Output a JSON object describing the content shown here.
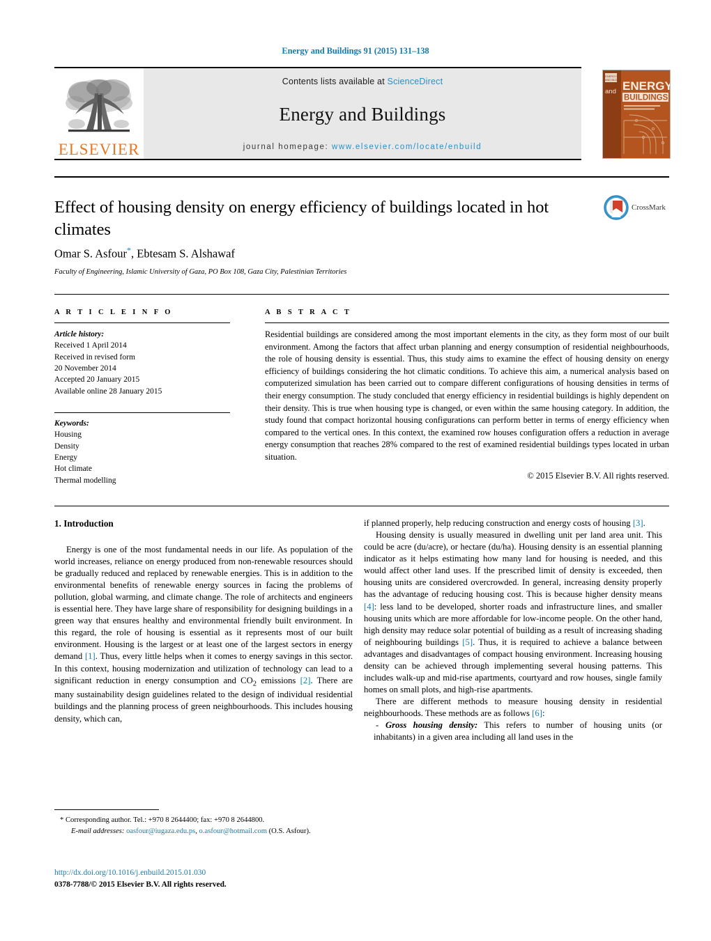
{
  "running_head": "Energy and Buildings 91 (2015) 131–138",
  "masthead": {
    "contents_prefix": "Contents lists available at ",
    "sciencedirect": "ScienceDirect",
    "journal_name": "Energy and Buildings",
    "homepage_prefix": "journal homepage: ",
    "homepage_url": "www.elsevier.com/locate/enbuild",
    "publisher_wordmark": "ELSEVIER",
    "cover_line_and": "and",
    "cover_line_energy": "ENERGY",
    "cover_line_buildings": "BUILDINGS",
    "link_color": "#2a8fc4",
    "band_bg": "#e8e8e8",
    "elsevier_orange": "#e87722"
  },
  "article": {
    "title": "Effect of housing density on energy efficiency of buildings located in hot climates",
    "authors": "Omar S. Asfour, Ebtesam S. Alshawaf",
    "author_first": "Omar S. Asfour",
    "author_second": ", Ebtesam S. Alshawaf",
    "corresponding_marker": "*",
    "affiliation": "Faculty of Engineering, Islamic University of Gaza, PO Box 108, Gaza City, Palestinian Territories",
    "crossmark_label": "CrossMark"
  },
  "info": {
    "heading": "A R T I C L E   I N F O",
    "history_label": "Article history:",
    "history": [
      "Received 1 April 2014",
      "Received in revised form",
      "20 November 2014",
      "Accepted 20 January 2015",
      "Available online 28 January 2015"
    ],
    "keywords_label": "Keywords:",
    "keywords": [
      "Housing",
      "Density",
      "Energy",
      "Hot climate",
      "Thermal modelling"
    ]
  },
  "abstract": {
    "heading": "A B S T R A C T",
    "text": "Residential buildings are considered among the most important elements in the city, as they form most of our built environment. Among the factors that affect urban planning and energy consumption of residential neighbourhoods, the role of housing density is essential. Thus, this study aims to examine the effect of housing density on energy efficiency of buildings considering the hot climatic conditions. To achieve this aim, a numerical analysis based on computerized simulation has been carried out to compare different configurations of housing densities in terms of their energy consumption. The study concluded that energy efficiency in residential buildings is highly dependent on their density. This is true when housing type is changed, or even within the same housing category. In addition, the study found that compact horizontal housing configurations can perform better in terms of energy efficiency when compared to the vertical ones. In this context, the examined row houses configuration offers a reduction in average energy consumption that reaches 28% compared to the rest of examined residential buildings types located in urban situation.",
    "copyright": "© 2015 Elsevier B.V. All rights reserved."
  },
  "body": {
    "section_title": "1.  Introduction",
    "left_p1_a": "Energy is one of the most fundamental needs in our life. As population of the world increases, reliance on energy produced from non-renewable resources should be gradually reduced and replaced by renewable energies. This is in addition to the environmental benefits of renewable energy sources in facing the problems of pollution, global warming, and climate change. The role of architects and engineers is essential here. They have large share of responsibility for designing buildings in a green way that ensures healthy and environmental friendly built environment. In this regard, the role of housing is essential as it represents most of our built environment. Housing is the largest or at least one of the largest sectors in energy demand ",
    "ref1": "[1]",
    "left_p1_b": ". Thus, every little helps when it comes to energy savings in this sector. In this context, housing modernization and utilization of technology can lead to a significant reduction in energy consumption and CO",
    "left_p1_sub": "2",
    "left_p1_c": " emissions ",
    "ref2": "[2]",
    "left_p1_d": ". There are many sustainability design guidelines related to the design of individual residential buildings and the planning process of green neighbourhoods. This includes housing density, which can,",
    "right_p1_cont": "if planned properly, help reducing construction and energy costs of housing ",
    "ref3": "[3]",
    "right_p1_end": ".",
    "right_p2_a": "Housing density is usually measured in dwelling unit per land area unit. This could be acre (du/acre), or hectare (du/ha). Housing density is an essential planning indicator as it helps estimating how many land for housing is needed, and this would affect other land uses. If the prescribed limit of density is exceeded, then housing units are considered overcrowded. In general, increasing density properly has the advantage of reducing housing cost. This is because higher density means ",
    "ref4": "[4]",
    "right_p2_b": ": less land to be developed, shorter roads and infrastructure lines, and smaller housing units which are more affordable for low-income people. On the other hand, high density may reduce solar potential of building as a result of increasing shading of neighbouring buildings ",
    "ref5": "[5]",
    "right_p2_c": ". Thus, it is required to achieve a balance between advantages and disadvantages of compact housing environment. Increasing housing density can be achieved through implementing several housing patterns. This includes walk-up and mid-rise apartments, courtyard and row houses, single family homes on small plots, and high-rise apartments.",
    "right_p3_a": "There are different methods to measure housing density in residential neighbourhoods. These methods are as follows ",
    "ref6": "[6]",
    "right_p3_b": ":",
    "bullet_dash": "-",
    "bullet_term": "Gross housing density:",
    "bullet_text": " This refers to number of housing units (or inhabitants) in a given area including all land uses in the",
    "ref_color": "#1a7aad"
  },
  "footnote": {
    "marker": "*",
    "corresponding": "Corresponding author. Tel.: +970 8 2644400; fax: +970 8 2644800.",
    "email_label": "E-mail addresses:",
    "email1": "oasfour@iugaza.edu.ps",
    "email_sep": ", ",
    "email2": "o.asfour@hotmail.com",
    "email_suffix": " (O.S. Asfour).",
    "doi": "http://dx.doi.org/10.1016/j.enbuild.2015.01.030",
    "issn": "0378-7788/© 2015 Elsevier B.V. All rights reserved."
  }
}
